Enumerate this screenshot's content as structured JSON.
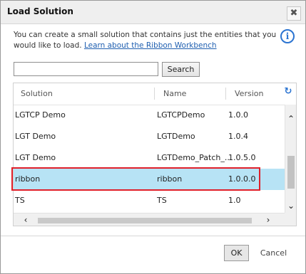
{
  "dialog": {
    "title": "Load Solution",
    "close_glyph": "✖",
    "description": "You can create a small solution that contains just the entities that you would like to load.",
    "link_text": "Learn about the Ribbon Workbench",
    "info_glyph": "i"
  },
  "search": {
    "value": "",
    "placeholder": "",
    "button_label": "Search"
  },
  "grid": {
    "columns": [
      "Solution",
      "Name",
      "Version"
    ],
    "refresh_glyph": "↻",
    "rows": [
      {
        "solution": "LGTCP Demo",
        "name": "LGTCPDemo",
        "version": "1.0.0",
        "selected": false
      },
      {
        "solution": "LGT Demo",
        "name": "LGTDemo",
        "version": "1.0.4",
        "selected": false
      },
      {
        "solution": "LGT Demo",
        "name": "LGTDemo_Patch_...",
        "version": "1.0.5.0",
        "selected": false
      },
      {
        "solution": "ribbon",
        "name": "ribbon",
        "version": "1.0.0.0",
        "selected": true
      },
      {
        "solution": "TS",
        "name": "TS",
        "version": "1.0",
        "selected": false
      }
    ],
    "scroll": {
      "up": "⌃",
      "down": "⌄",
      "left": "‹",
      "right": "›"
    }
  },
  "footer": {
    "ok_label": "OK",
    "cancel_label": "Cancel"
  },
  "colors": {
    "selected_row": "#b7e3f5",
    "highlight_border": "#e0202a",
    "link": "#1f5fb0",
    "info_icon": "#2b74d1"
  }
}
